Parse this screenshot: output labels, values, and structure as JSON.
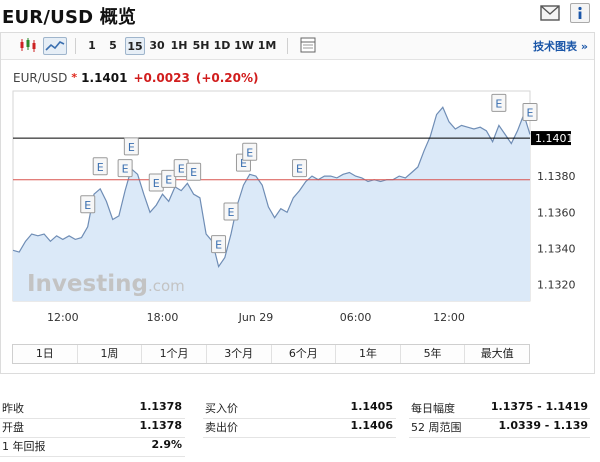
{
  "header": {
    "title": "EUR/USD 概览"
  },
  "toolbar": {
    "buttons": [
      "1",
      "5",
      "15",
      "30",
      "1H",
      "5H",
      "1D",
      "1W",
      "1M"
    ],
    "selected": "15",
    "tech_label": "技术图表 »"
  },
  "quote": {
    "symbol": "EUR/USD",
    "star": "*",
    "price": "1.1401",
    "change": "+0.0023",
    "change_pct": "(+0.20%)"
  },
  "chart_data": {
    "type": "area",
    "x_tick_labels": [
      "12:00",
      "18:00",
      "Jun 29",
      "06:00",
      "12:00"
    ],
    "y_tick_labels": [
      "1.1320",
      "1.1340",
      "1.1360",
      "1.1380"
    ],
    "ylim": [
      1.1311,
      1.1427
    ],
    "current_price_label": "1.1401",
    "reference_line": 1.1378,
    "watermark": "Investing.com",
    "grid": false,
    "series": [
      {
        "values": [
          1.1339,
          1.1338,
          1.1344,
          1.1348,
          1.1347,
          1.1348,
          1.1344,
          1.1347,
          1.1345,
          1.1347,
          1.1345,
          1.1346,
          1.1352,
          1.137,
          1.1373,
          1.1366,
          1.1356,
          1.1358,
          1.1372,
          1.1384,
          1.1381,
          1.137,
          1.136,
          1.1364,
          1.137,
          1.1366,
          1.1374,
          1.1372,
          1.1376,
          1.137,
          1.1368,
          1.1348,
          1.1344,
          1.133,
          1.1335,
          1.1348,
          1.1364,
          1.1375,
          1.1381,
          1.138,
          1.1375,
          1.1363,
          1.1357,
          1.1362,
          1.136,
          1.1368,
          1.1372,
          1.1377,
          1.138,
          1.1378,
          1.138,
          1.138,
          1.1379,
          1.1381,
          1.1382,
          1.138,
          1.1379,
          1.1377,
          1.1378,
          1.1377,
          1.1378,
          1.1378,
          1.138,
          1.1379,
          1.1382,
          1.1385,
          1.1394,
          1.1402,
          1.1414,
          1.1418,
          1.141,
          1.1406,
          1.1408,
          1.1407,
          1.1406,
          1.1407,
          1.1405,
          1.1399,
          1.1408,
          1.1403,
          1.1398,
          1.1405,
          1.1414,
          1.1403
        ]
      }
    ],
    "event_markers": [
      {
        "label": "E",
        "index": 12
      },
      {
        "label": "E",
        "index": 14
      },
      {
        "label": "E",
        "index": 18
      },
      {
        "label": "E",
        "index": 19
      },
      {
        "label": "E",
        "index": 23
      },
      {
        "label": "E",
        "index": 25
      },
      {
        "label": "E",
        "index": 27
      },
      {
        "label": "E",
        "index": 29
      },
      {
        "label": "E",
        "index": 33
      },
      {
        "label": "E",
        "index": 35
      },
      {
        "label": "E",
        "index": 37
      },
      {
        "label": "E",
        "index": 38
      },
      {
        "label": "E",
        "index": 46
      },
      {
        "label": "E",
        "index": 78
      },
      {
        "label": "E",
        "index": 83
      }
    ]
  },
  "ranges": [
    "1日",
    "1周",
    "1个月",
    "3个月",
    "6个月",
    "1年",
    "5年",
    "最大值"
  ],
  "stats": [
    [
      {
        "label": "昨收",
        "value": "1.1378"
      },
      {
        "label": "买入价",
        "value": "1.1405"
      },
      {
        "label": "每日幅度",
        "value": "1.1375 - 1.1419"
      }
    ],
    [
      {
        "label": "开盘",
        "value": "1.1378"
      },
      {
        "label": "卖出价",
        "value": "1.1406"
      },
      {
        "label": "52 周范围",
        "value": "1.0339 - 1.139"
      }
    ],
    [
      {
        "label": "1 年回报",
        "value": "2.9%"
      }
    ]
  ],
  "colors": {
    "area_fill": "#dbe9f8",
    "area_line": "#6f8db5",
    "current_line": "#000000",
    "reference_line": "#d9534f",
    "change": "#d11d1d",
    "link": "#1a56a8",
    "watermark": "#c3c3c3"
  }
}
